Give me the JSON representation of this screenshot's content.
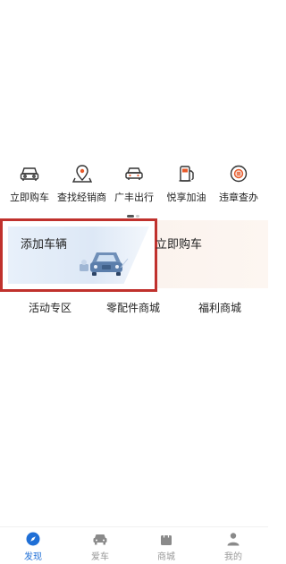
{
  "quick_actions": [
    {
      "label": "立即购车",
      "icon": "car-front-icon"
    },
    {
      "label": "查找经销商",
      "icon": "location-pin-icon"
    },
    {
      "label": "广丰出行",
      "icon": "car-travel-icon"
    },
    {
      "label": "悦享加油",
      "icon": "fuel-pump-icon"
    },
    {
      "label": "违章查办",
      "icon": "violation-search-icon"
    }
  ],
  "banners": {
    "add_vehicle": {
      "title": "添加车辆",
      "highlight_color": "#c0312d"
    },
    "buy_car": {
      "title": "立即购车"
    }
  },
  "tabs": [
    {
      "label": "活动专区"
    },
    {
      "label": "零配件商城"
    },
    {
      "label": "福利商城"
    }
  ],
  "bottom_nav": {
    "active_color": "#1f6fd6",
    "items": [
      {
        "label": "发现",
        "icon": "discover-icon",
        "active": true
      },
      {
        "label": "爱车",
        "icon": "car-icon",
        "active": false
      },
      {
        "label": "商城",
        "icon": "shopping-bag-icon",
        "active": false
      },
      {
        "label": "我的",
        "icon": "profile-icon",
        "active": false
      }
    ]
  }
}
